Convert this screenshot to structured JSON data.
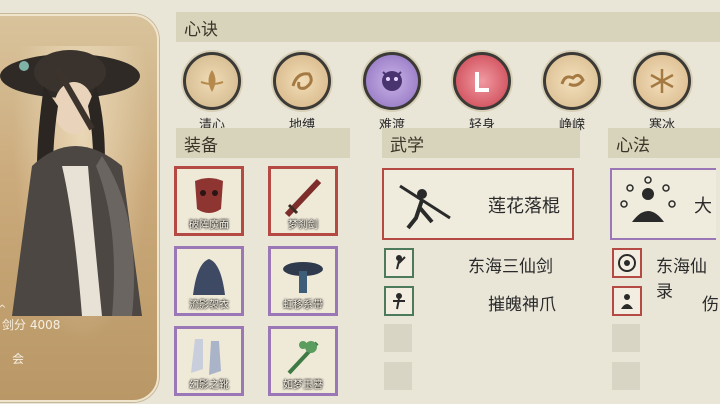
{
  "character": {
    "score_label": "剑分 4008",
    "sub_label": "会"
  },
  "xinjue": {
    "header": "心诀",
    "skills": [
      {
        "name": "清心",
        "icon": "swirl-lotus-icon",
        "color": "#cfb489"
      },
      {
        "name": "地缚",
        "icon": "swirl-earth-icon",
        "color": "#d4b384"
      },
      {
        "name": "难渡",
        "icon": "demon-mask-icon",
        "color": "#9a7bc4"
      },
      {
        "name": "轻身",
        "icon": "light-body-icon",
        "color": "#d25a63"
      },
      {
        "name": "峥嵘",
        "icon": "cloud-swirl-icon",
        "color": "#d7b98b"
      },
      {
        "name": "寒冰",
        "icon": "snowflake-icon",
        "color": "#d8b688"
      }
    ]
  },
  "equipment": {
    "header": "装备",
    "items": [
      {
        "name": "破阵魔面",
        "rarity": "red"
      },
      {
        "name": "梦刹剑",
        "rarity": "red"
      },
      {
        "name": "流影袈衣",
        "rarity": "purple"
      },
      {
        "name": "虹移系带",
        "rarity": "purple"
      },
      {
        "name": "幻影之靴",
        "rarity": "purple"
      },
      {
        "name": "如梦玉簪",
        "rarity": "purple"
      }
    ]
  },
  "wuxue": {
    "header": "武学",
    "main": "莲花落棍",
    "list": [
      "东海三仙剑",
      "摧魄神爪"
    ]
  },
  "xinfa": {
    "header": "心法",
    "main": "大",
    "list": [
      "东海仙录",
      "伤"
    ]
  },
  "colors": {
    "red": "#b54a45",
    "purple": "#9c77b7",
    "header_bg": "#d8d3bb",
    "bg": "#e9e6d8"
  }
}
